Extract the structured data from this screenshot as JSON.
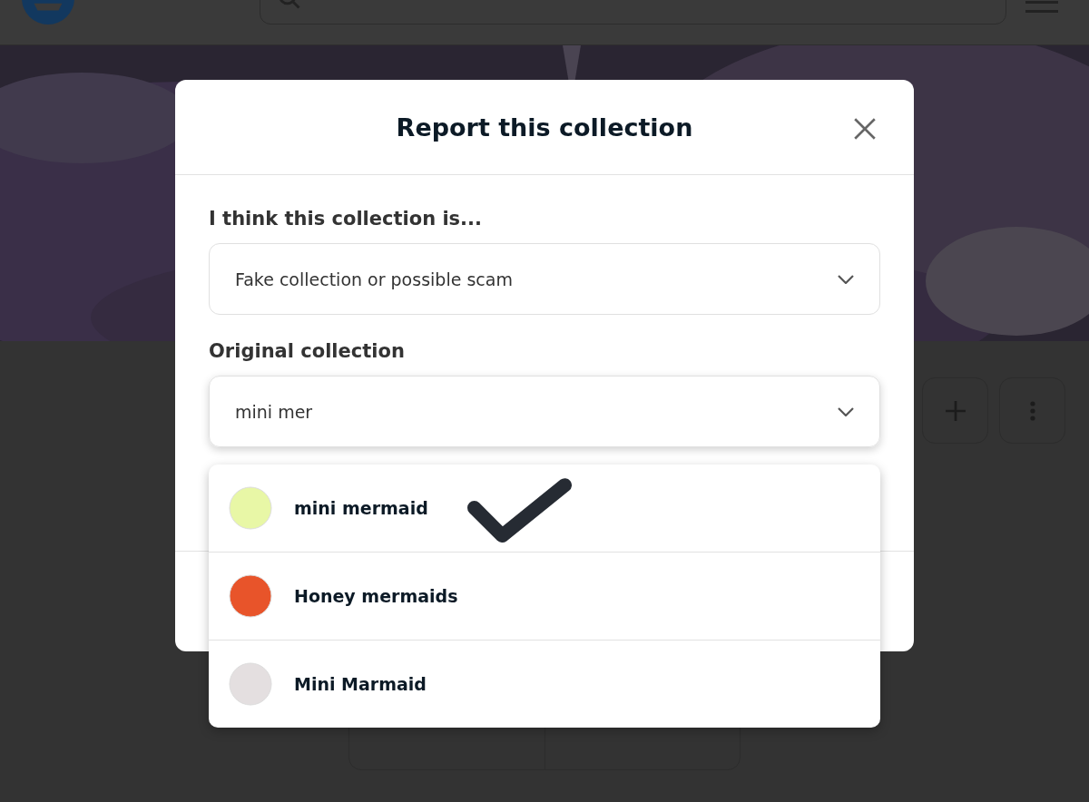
{
  "dialog": {
    "title": "Report this collection",
    "fields": [
      {
        "kind": "select",
        "label": "I think this collection is...",
        "value": "Fake collection or possible scam"
      },
      {
        "kind": "search",
        "label": "Original collection",
        "value": "mini mer"
      }
    ],
    "suggestions": [
      {
        "name": "mini mermaid",
        "color": "#e8f7a6"
      },
      {
        "name": "Honey mermaids",
        "color": "#e8542a"
      },
      {
        "name": "Mini Marmaid",
        "color": "#e4dfe0"
      }
    ]
  }
}
